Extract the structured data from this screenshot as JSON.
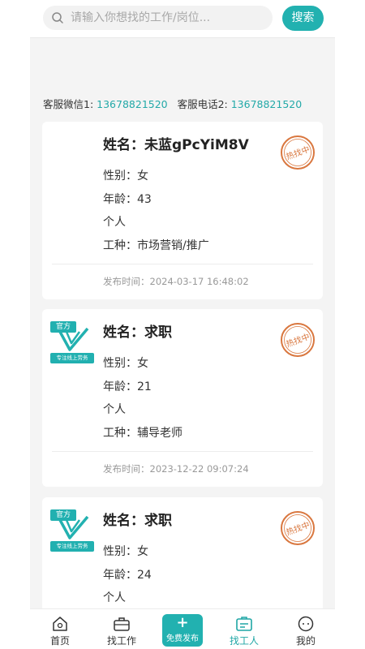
{
  "search": {
    "placeholder": "请输入你想找的工作/岗位...",
    "button_label": "搜索"
  },
  "contact": {
    "wechat_label": "客服微信1:",
    "wechat_value": "13678821520",
    "phone_label": "客服电话2:",
    "phone_value": "13678821520"
  },
  "cards": [
    {
      "name": "姓名：未蓝gPcYiM8V",
      "gender": "性别：女",
      "age": "年龄：43",
      "type": "个人",
      "job": "工种：市场营销/推广",
      "time": "发布时间：2024-03-17 16:48:02",
      "has_logo": false,
      "stamp": "热找中"
    },
    {
      "name": "姓名：求职",
      "gender": "性别：女",
      "age": "年龄：21",
      "type": "个人",
      "job": "工种：辅导老师",
      "time": "发布时间：2023-12-22 09:07:24",
      "has_logo": true,
      "logo_tag": "官方",
      "logo_slogan": "专注线上劳务",
      "stamp": "热找中"
    },
    {
      "name": "姓名：求职",
      "gender": "性别：女",
      "age": "年龄：24",
      "type": "个人",
      "has_logo": true,
      "logo_tag": "官方",
      "logo_slogan": "专注线上劳务",
      "stamp": "热找中"
    }
  ],
  "tabbar": {
    "home": "首页",
    "find_job": "找工作",
    "publish": "免费发布",
    "find_worker": "找工人",
    "mine": "我的",
    "active": "find_worker"
  },
  "colors": {
    "accent": "#22b1b0",
    "stamp": "#d9773f",
    "link": "#23a9a8"
  }
}
